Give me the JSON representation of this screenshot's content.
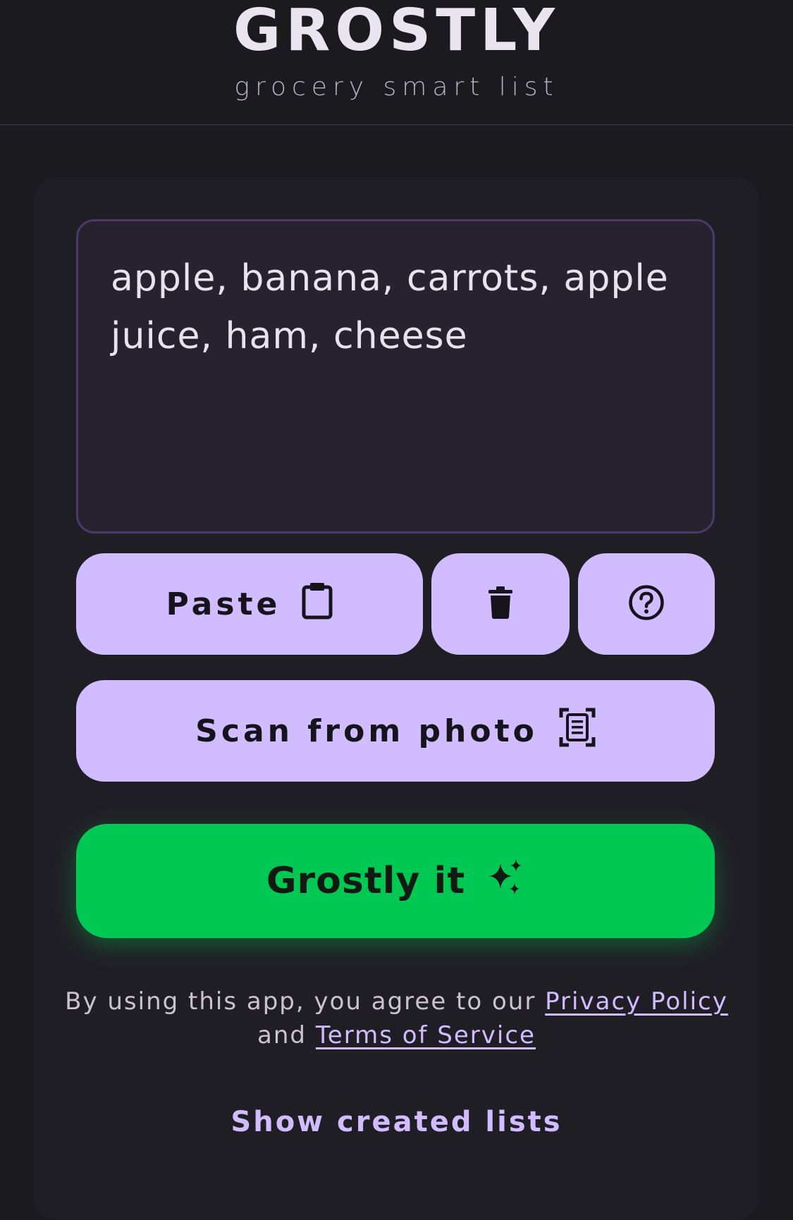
{
  "header": {
    "brand": "GROSTLY",
    "tagline": "grocery smart list"
  },
  "input": {
    "value": "apple, banana, carrots, apple juice, ham, cheese"
  },
  "actions": {
    "paste_label": "Paste",
    "paste_icon": "clipboard-icon",
    "clear_icon": "trash-icon",
    "help_icon": "help-circle-icon",
    "scan_label": "Scan from photo",
    "scan_icon": "document-scan-icon",
    "primary_label": "Grostly it",
    "primary_icon": "sparkles-icon"
  },
  "legal": {
    "prefix": "By using this app, you agree to our",
    "privacy_link": "Privacy Policy",
    "joiner": "and",
    "terms_link": "Terms of Service"
  },
  "footer": {
    "show_lists_label": "Show created lists"
  },
  "colors": {
    "background": "#1b1a1f",
    "card": "#201e25",
    "accent": "#d0bcfe",
    "primary": "#00c853"
  }
}
